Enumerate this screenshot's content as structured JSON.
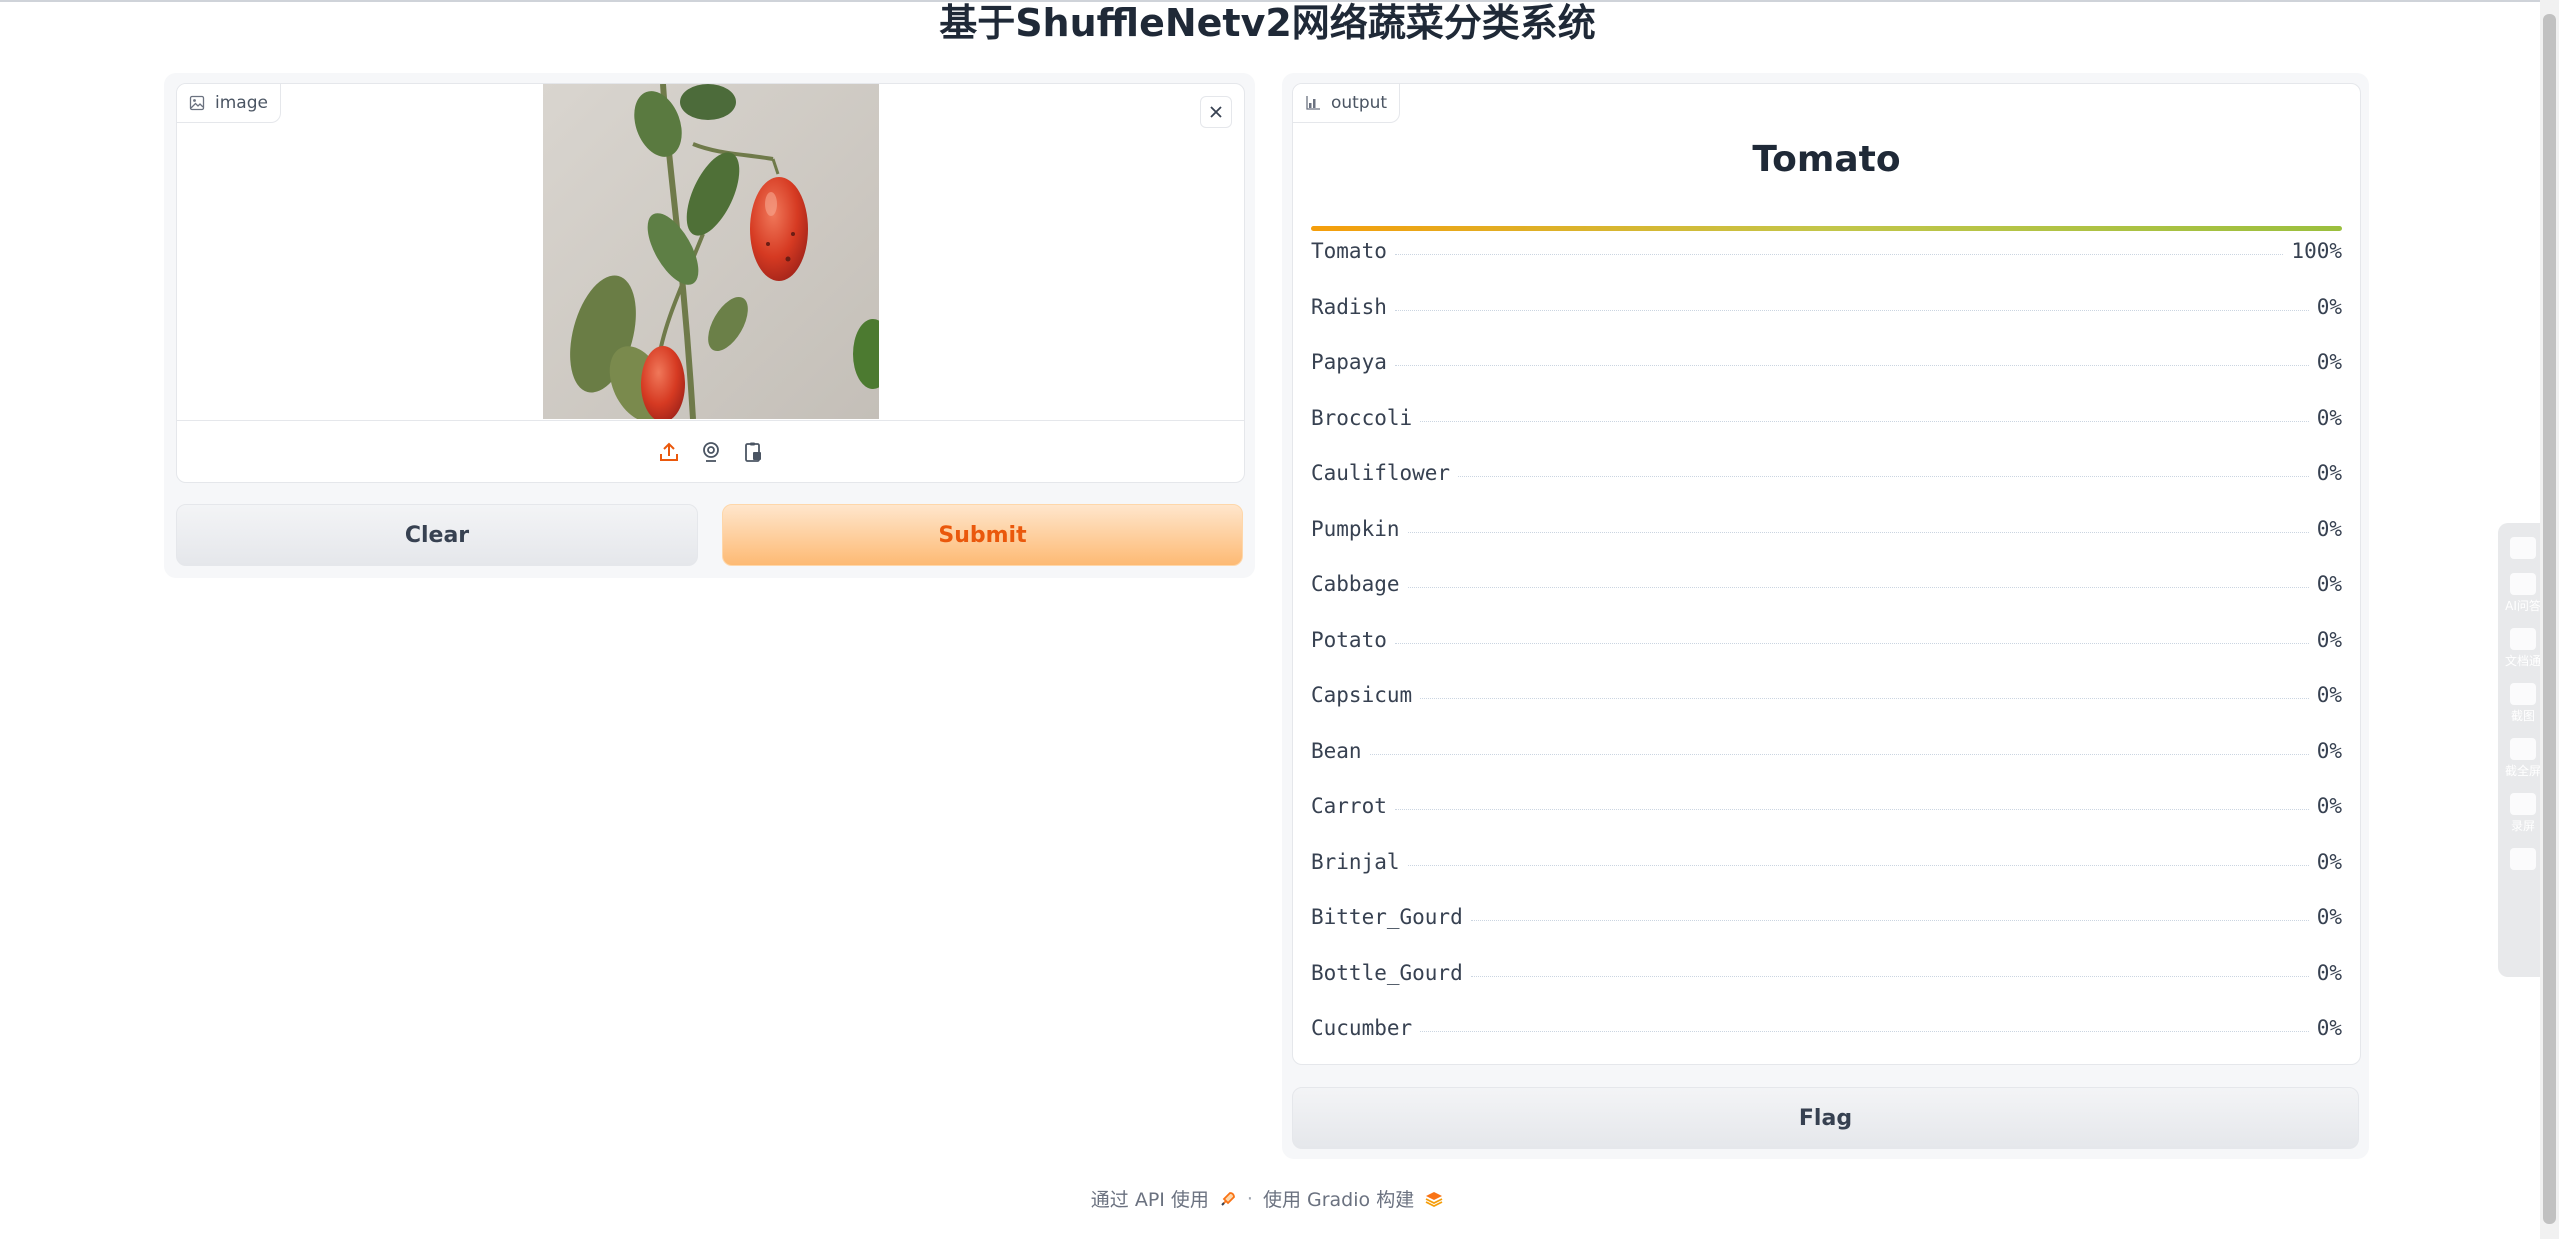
{
  "page": {
    "title": "基于ShuffleNetv2网络蔬菜分类系统"
  },
  "input": {
    "label": "image",
    "source_buttons": [
      "upload-icon",
      "webcam-icon",
      "clipboard-icon"
    ]
  },
  "buttons": {
    "clear": "Clear",
    "submit": "Submit",
    "flag": "Flag"
  },
  "output": {
    "label": "output",
    "top_class": "Tomato",
    "top_confidence": 1.0,
    "confidences": [
      {
        "label": "Tomato",
        "value": "100%"
      },
      {
        "label": "Radish",
        "value": "0%"
      },
      {
        "label": "Papaya",
        "value": "0%"
      },
      {
        "label": "Broccoli",
        "value": "0%"
      },
      {
        "label": "Cauliflower",
        "value": "0%"
      },
      {
        "label": "Pumpkin",
        "value": "0%"
      },
      {
        "label": "Cabbage",
        "value": "0%"
      },
      {
        "label": "Potato",
        "value": "0%"
      },
      {
        "label": "Capsicum",
        "value": "0%"
      },
      {
        "label": "Bean",
        "value": "0%"
      },
      {
        "label": "Carrot",
        "value": "0%"
      },
      {
        "label": "Brinjal",
        "value": "0%"
      },
      {
        "label": "Bitter_Gourd",
        "value": "0%"
      },
      {
        "label": "Bottle_Gourd",
        "value": "0%"
      },
      {
        "label": "Cucumber",
        "value": "0%"
      }
    ]
  },
  "footer": {
    "api_text": "通过 API 使用",
    "separator": "·",
    "built_text": "使用 Gradio 构建"
  },
  "side_toolbar": {
    "items": [
      "AI问答",
      "文档通",
      "截图",
      "截全屏",
      "录屏"
    ]
  },
  "colors": {
    "accent": "#ea580c",
    "submit_bg": "#fdba74",
    "bar_start": "#f59e0b",
    "bar_end": "#9bbf3e"
  }
}
